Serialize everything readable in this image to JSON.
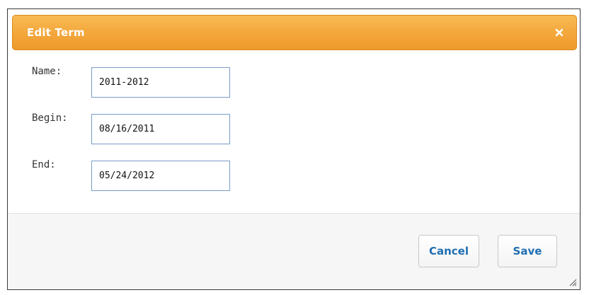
{
  "dialog": {
    "title": "Edit Term",
    "close_icon": "close-icon",
    "close_glyph": "✖"
  },
  "form": {
    "name_label": "Name:",
    "name_value": "2011-2012",
    "begin_label": "Begin:",
    "begin_value": "08/16/2011",
    "end_label": "End:",
    "end_value": "05/24/2012"
  },
  "footer": {
    "cancel_label": "Cancel",
    "save_label": "Save"
  },
  "colors": {
    "titlebar": "#f3a63a",
    "button_text": "#1f6fb2",
    "input_border": "#7a9cc6"
  }
}
